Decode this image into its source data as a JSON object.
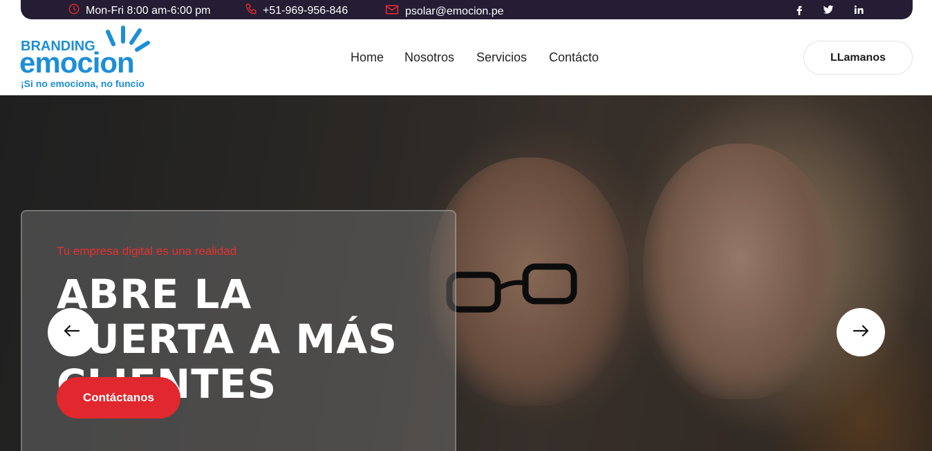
{
  "topbar": {
    "hours": "Mon-Fri 8:00 am-6:00 pm",
    "phone": "+51-969-956-846",
    "email": "psolar@emocion.pe",
    "icons": [
      "clock-icon",
      "phone-icon",
      "mail-icon"
    ],
    "social": [
      "facebook-icon",
      "twitter-icon",
      "linkedin-icon"
    ]
  },
  "logo": {
    "top": "BRANDING",
    "main": "emocion",
    "tagline": "¡Si no emociona, no funcio"
  },
  "nav": {
    "items": [
      "Home",
      "Nosotros",
      "Servicios",
      "Contácto"
    ]
  },
  "header": {
    "call_label": "LLamanos"
  },
  "hero": {
    "eyebrow": "Tu empresa digital es una realidad",
    "headline": "ABRE LA PUERTA A MÁS CLIENTES",
    "cta_label": "Contáctanos",
    "prev_icon": "arrow-left-icon",
    "next_icon": "arrow-right-icon"
  },
  "colors": {
    "topbar_bg": "#241d33",
    "accent_red": "#e0282e",
    "brand_blue": "#1d8ed8"
  }
}
